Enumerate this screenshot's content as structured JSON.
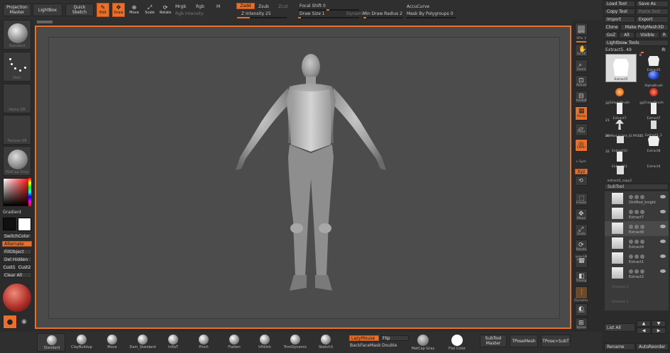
{
  "top_left": {
    "projection_master": "Projection\nMaster",
    "lightbox": "LightBox",
    "quick_sketch": "Quick\nSketch"
  },
  "transform": {
    "edit": "Edit",
    "draw": "Draw",
    "move": "Move",
    "scale": "Scale",
    "rotate": "Rotate"
  },
  "channels": {
    "mrgb": "Mrgb",
    "rgb": "Rgb",
    "m": "M",
    "rgb_intensity": "Rgb Intensity"
  },
  "sculpt": {
    "zadd": "Zadd",
    "zsub": "Zsub",
    "zcut": "Zcut",
    "z_intensity": "Z Intensity 25",
    "z_intensity_value": 0.25
  },
  "focal": {
    "focal_shift": "Focal Shift 0",
    "draw_size": "Draw Size 1",
    "dynamic": "Dynamic"
  },
  "misc": {
    "min_draw_radius": "Min Draw Radius 2",
    "accucurve": "AccuCurve",
    "mask_by_polygroups": "Mask By Polygroups 0"
  },
  "left_panel": {
    "standard_label": "Standard",
    "dots_label": "Dots",
    "alpha_label": "Alpha Off",
    "texture_label": "Texture Off",
    "matcap_label": "MatCap Gray",
    "gradient": "Gradient",
    "switch_color": "SwitchColor",
    "alternate": "Alternate",
    "fill_object": "FillObject",
    "del_hidden": "Del Hidden",
    "cust1": "Cust1",
    "cust2": "Cust2",
    "clear_all": "Clear All"
  },
  "right_shelf": {
    "bpr": "BPR",
    "spix": "SPix 3",
    "scroll": "Scroll",
    "zoom": "Zoom",
    "actual": "Actual",
    "aahalf": "AAHalf",
    "persp": "Persp",
    "floor": "Floor",
    "local": "Local",
    "lsym": "L.Sym",
    "xyz": "Xyz",
    "frame": "Frame",
    "move": "Move",
    "scale": "Scale",
    "rotate": "Rotate",
    "line_fill": "Line Fill\nPolyF",
    "transp": "Transp",
    "dynamic": "Dynamic",
    "solo": "Solo",
    "xpose": "Xpose"
  },
  "tool_panel": {
    "load_tool": "Load Tool",
    "save_as": "Save As",
    "copy_tool": "Copy Tool",
    "paste_tool": "Paste Tool",
    "import": "Import",
    "export": "Export",
    "clone": "Clone",
    "make_polymesh": "Make PolyMesh3D",
    "goz": "GoZ",
    "all": "All",
    "visible": "Visible",
    "r": "R",
    "lightbox_tools": "Lightbox▸ Tools",
    "current_tool": "Extract5. 49",
    "current_r": "R",
    "tools": [
      {
        "num": "",
        "name": "Extract5"
      },
      {
        "num": "8",
        "name": "Extract5"
      },
      {
        "num": "",
        "name": "AlphaBrush"
      },
      {
        "num": "",
        "name": "SimpleBrush"
      },
      {
        "num": "",
        "name": "EraserBrush"
      },
      {
        "num": "20",
        "name": "Extract7"
      },
      {
        "num": "20",
        "name": "Extract7"
      },
      {
        "num": "21",
        "name": "DirtMod_knight_03.PM3D"
      },
      {
        "num": "",
        "name": "Extract1_1"
      },
      {
        "num": "20",
        "name": "Extract10"
      },
      {
        "num": "31",
        "name": "Extract8"
      },
      {
        "num": "32",
        "name": ""
      },
      {
        "num": "",
        "name": "Extract11"
      },
      {
        "num": "",
        "name": "Extract4"
      },
      {
        "num": "",
        "name": "extract2_copy1"
      }
    ],
    "subtool_header": "SubTool",
    "subtools": [
      {
        "name": "DirtMod_knight",
        "selected": false
      },
      {
        "name": "Extract7",
        "selected": false
      },
      {
        "name": "Extract8",
        "selected": true
      },
      {
        "name": "Extract4",
        "selected": false
      },
      {
        "name": "Extract1",
        "selected": false
      },
      {
        "name": "Extract2",
        "selected": false
      },
      {
        "name": "Unused 1",
        "selected": false
      },
      {
        "name": "Unused 1",
        "selected": false
      }
    ],
    "list_all": "List All",
    "rename": "Rename",
    "auto_reorder": "AutoReorder"
  },
  "bottom_bar": {
    "brushes": [
      "Standard",
      "ClayBuildup",
      "Move",
      "Dam_Standard",
      "InflaT",
      "Pinch",
      "Flatten",
      "hPolish",
      "TrimDynamic",
      "Sketch3"
    ],
    "lazymouse": "LazyMouse",
    "flip": "Flip",
    "backface": "BackFaceMask",
    "double": "Double",
    "matcap_gray": "MatCap Gray",
    "flat_color": "Flat Color",
    "subtool_master": "SubTool\nMaster",
    "tposemesh": "TPoseMesh",
    "tpose_subt": "TPose>SubT"
  },
  "colors": {
    "accent": "#e8702a",
    "bg": "#2b2b2b",
    "canvas": "#4c4c4c"
  }
}
